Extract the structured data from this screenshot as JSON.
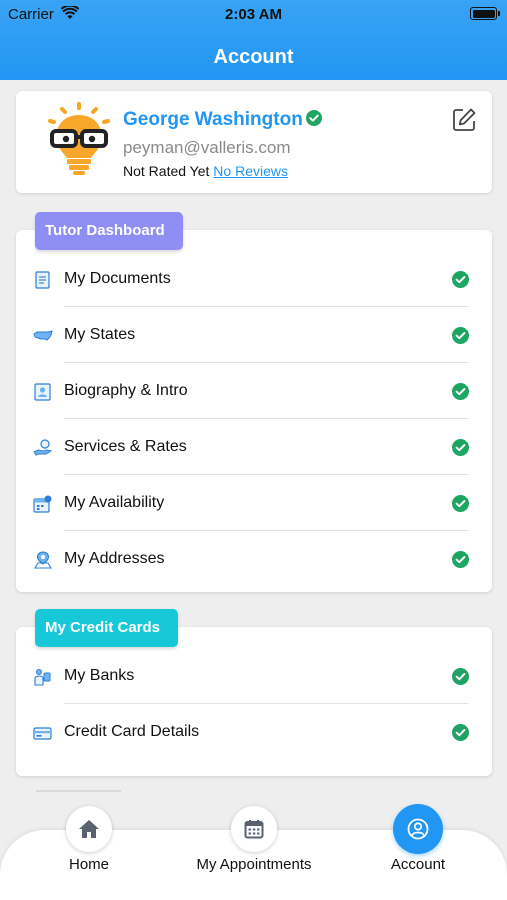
{
  "status_bar": {
    "carrier": "Carrier",
    "time": "2:03 AM"
  },
  "header": {
    "title": "Account"
  },
  "profile": {
    "name": "George Washington",
    "email": "peyman@valleris.com",
    "rating_text": "Not Rated Yet",
    "reviews_link": "No Reviews"
  },
  "tutor_section": {
    "badge": "Tutor Dashboard",
    "items": [
      {
        "label": "My Documents",
        "icon": "document-icon"
      },
      {
        "label": "My States",
        "icon": "usa-map-icon"
      },
      {
        "label": "Biography & Intro",
        "icon": "biography-icon"
      },
      {
        "label": "Services & Rates",
        "icon": "rates-hand-icon"
      },
      {
        "label": "My Availability",
        "icon": "calendar-icon"
      },
      {
        "label": "My Addresses",
        "icon": "location-pin-icon"
      }
    ]
  },
  "cards_section": {
    "badge": "My Credit Cards",
    "items": [
      {
        "label": "My Banks",
        "icon": "bank-icon"
      },
      {
        "label": "Credit Card Details",
        "icon": "credit-card-icon"
      }
    ]
  },
  "tabbar": {
    "home": "Home",
    "appointments": "My Appointments",
    "account": "Account",
    "active": "account"
  },
  "colors": {
    "primary": "#2196f3",
    "tutor_badge": "#8e8ef5",
    "cards_badge": "#17c9d8",
    "check_green": "#1fa463"
  }
}
